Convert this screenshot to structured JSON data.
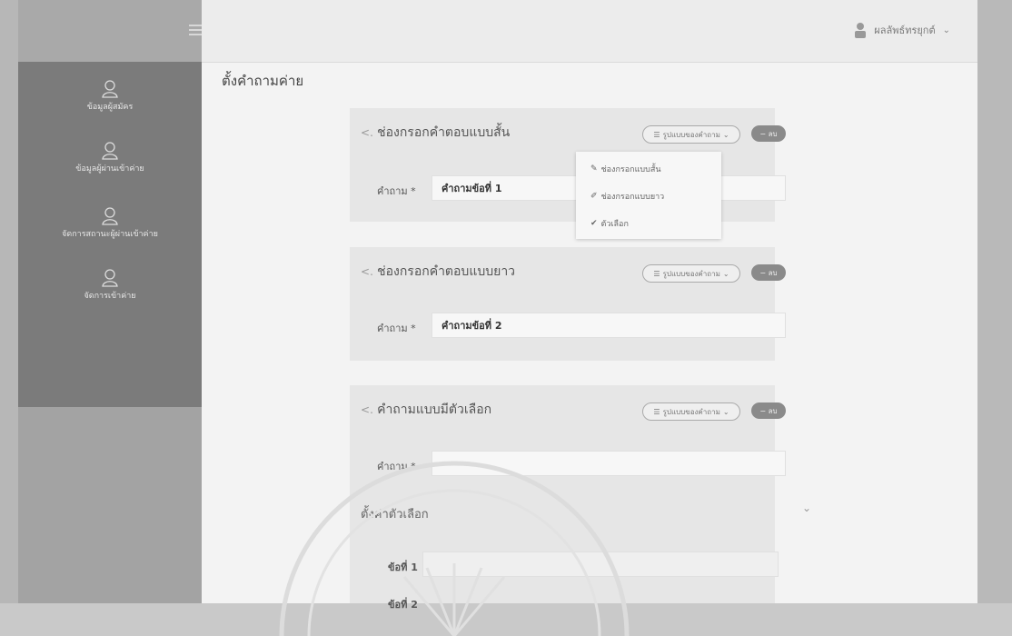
{
  "page_title": "ตั้งคำถามค่าย",
  "user": {
    "name": "ผลลัพธ์ทรยุกต์"
  },
  "sidebar": {
    "items": [
      {
        "label": "ข้อมูลผู้สมัคร",
        "icon": "user-icon"
      },
      {
        "label": "ข้อมูลผู้ผ่านเข้าค่าย",
        "icon": "user-icon"
      },
      {
        "label": "จัดการสถานะผู้ผ่านเข้าค่าย",
        "icon": "user-icon"
      },
      {
        "label": "จัดการเข้าค่าย",
        "icon": "user-icon"
      }
    ]
  },
  "cards": [
    {
      "title": "ช่องกรอกคำตอบแบบสั้น",
      "type_button": "รูปแบบของคำถาม",
      "delete_button": "ลบ",
      "question_label": "คำถาม *",
      "question_value": "คำถามข้อที่ 1"
    },
    {
      "title": "ช่องกรอกคำตอบแบบยาว",
      "type_button": "รูปแบบของคำถาม",
      "delete_button": "ลบ",
      "question_label": "คำถาม *",
      "question_value": "คำถามข้อที่ 2"
    },
    {
      "title": "คำถามแบบมีตัวเลือก",
      "type_button": "รูปแบบของคำถาม",
      "delete_button": "ลบ",
      "question_label": "คำถาม *",
      "question_value": ""
    }
  ],
  "dropdown": {
    "items": [
      {
        "label": "ช่องกรอกแบบสั้น",
        "icon": "pencil-icon"
      },
      {
        "label": "ช่องกรอกแบบยาว",
        "icon": "edit-icon"
      },
      {
        "label": "ตัวเลือก",
        "icon": "check-circle-icon"
      }
    ]
  },
  "choices": {
    "section_title": "ตั้งค่าตัวเลือก",
    "items": [
      {
        "label": "ข้อที่ 1"
      },
      {
        "label": "ข้อที่ 2"
      }
    ]
  }
}
